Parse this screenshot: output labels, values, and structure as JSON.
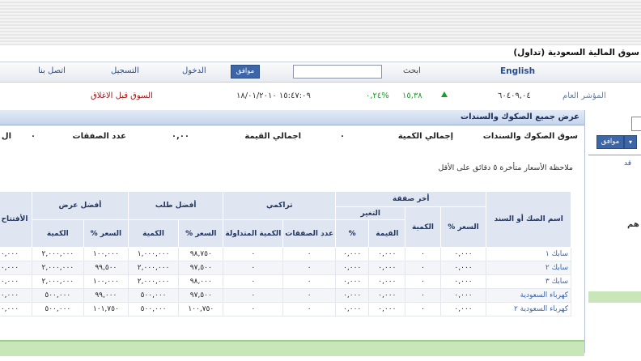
{
  "site": {
    "title": "سوق المالية السعودية (تداول)"
  },
  "nav": {
    "english": "English",
    "search_label": "ابحث",
    "search_value": "",
    "ok_label": "موافق",
    "login": "الدخول",
    "register": "التسجيل",
    "contact": "اتصل بنا"
  },
  "index_bar": {
    "label": "المؤشر العام",
    "value": "٦٠٤٠٩,٠٤",
    "change": "١٥,٣٨",
    "change_pct": "%٠,٢٤",
    "datetime": "١٥:٤٧:٠٩ ١٨/٠١/٢٠١٠",
    "market_status": "السوق قبل الاغلاق",
    "up_color": "#1e9a2e",
    "status_color": "#a01818"
  },
  "left_panel": {
    "ok_label": "موافق",
    "link": "قد",
    "label": "هم"
  },
  "panel": {
    "title": "عرض جميع الصكوك والسندات",
    "summary": {
      "market": "سوق الصكوك والسندات",
      "total_qty_label": "إجمالي الكمية",
      "total_qty_value": "٠",
      "total_value_label": "اجمالي القيمة",
      "total_value_value": "٠,٠٠",
      "deals_label": "عدد الصفقات",
      "deals_value": "٠",
      "extra": "ال"
    },
    "note": "ملاحظة الأسعار متأخرة ٥ دقائق على الأقل"
  },
  "table": {
    "groups": {
      "name": "اسم الصك أو السند",
      "last_deal": "أخر صفقة",
      "change": "التغير",
      "cumulative": "تراكمي",
      "best_bid": "أفضل طلب",
      "best_offer": "أفضل عرض",
      "open": "الأفتتاح %"
    },
    "cols": {
      "price_pct": "السعر %",
      "qty": "الكمية",
      "value": "القيمة",
      "pct": "%",
      "deals": "عدد الصفقات",
      "traded_qty": "الكمية المتداولة"
    },
    "rows": [
      {
        "name": "سابك ١",
        "last_price": "٠,٠٠٠",
        "last_qty": "٠",
        "chg_val": "٠,٠٠٠",
        "chg_pct": "٠,٠٠٠",
        "deals": "٠",
        "traded": "٠",
        "bid_price": "٩٨,٧٥٠",
        "bid_qty": "١,٠٠٠,٠٠٠",
        "offer_price": "١٠٠,٠٠٠",
        "offer_qty": "٢,٠٠٠,٠٠٠",
        "open": "٠,٠٠٠"
      },
      {
        "name": "سابك ٢",
        "last_price": "٠,٠٠٠",
        "last_qty": "٠",
        "chg_val": "٠,٠٠٠",
        "chg_pct": "٠,٠٠٠",
        "deals": "٠",
        "traded": "٠",
        "bid_price": "٩٧,٥٠٠",
        "bid_qty": "٢,٠٠٠,٠٠٠",
        "offer_price": "٩٩,٥٠٠",
        "offer_qty": "٢,٠٠٠,٠٠٠",
        "open": "٠,٠٠٠"
      },
      {
        "name": "سابك ٣",
        "last_price": "٠,٠٠٠",
        "last_qty": "٠",
        "chg_val": "٠,٠٠٠",
        "chg_pct": "٠,٠٠٠",
        "deals": "٠",
        "traded": "٠",
        "bid_price": "٩٨,٠٠٠",
        "bid_qty": "٢,٠٠٠,٠٠٠",
        "offer_price": "١٠٠,٠٠٠",
        "offer_qty": "٢,٠٠٠,٠٠٠",
        "open": "٠,٠٠٠"
      },
      {
        "name": "كهرباء السعودية",
        "last_price": "٠,٠٠٠",
        "last_qty": "٠",
        "chg_val": "٠,٠٠٠",
        "chg_pct": "٠,٠٠٠",
        "deals": "٠",
        "traded": "٠",
        "bid_price": "٩٧,٥٠٠",
        "bid_qty": "٥٠٠,٠٠٠",
        "offer_price": "٩٩,٠٠٠",
        "offer_qty": "٥٠٠,٠٠٠",
        "open": "٠,٠٠٠"
      },
      {
        "name": "كهرباء السعودية ٢",
        "last_price": "٠,٠٠٠",
        "last_qty": "٠",
        "chg_val": "٠,٠٠٠",
        "chg_pct": "٠,٠٠٠",
        "deals": "٠",
        "traded": "٠",
        "bid_price": "١٠٠,٧٥٠",
        "bid_qty": "٥٠٠,٠٠٠",
        "offer_price": "١٠١,٧٥٠",
        "offer_qty": "٥٠٠,٠٠٠",
        "open": "٠,٠٠٠"
      }
    ]
  }
}
